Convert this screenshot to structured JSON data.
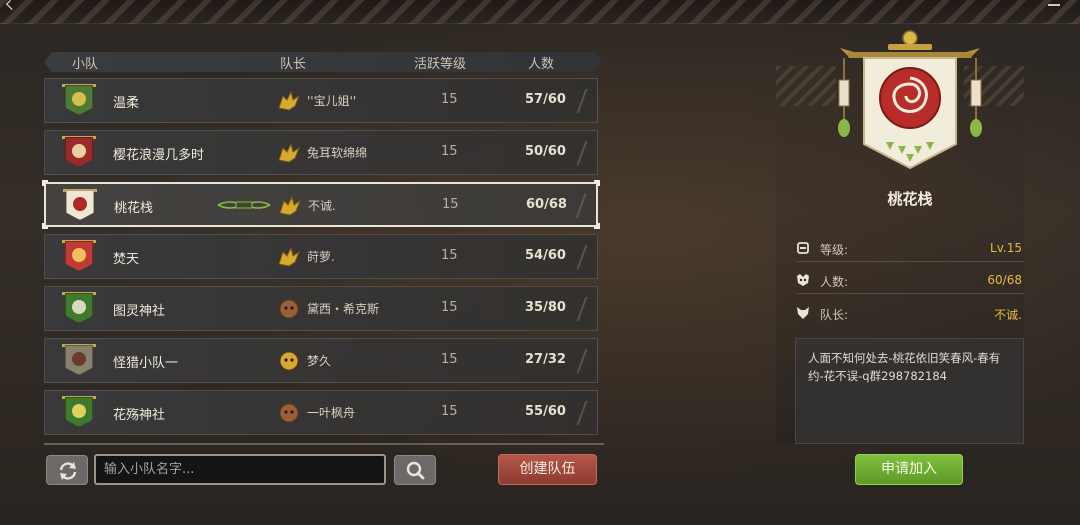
{
  "list": {
    "headers": {
      "team": "小队",
      "leader": "队长",
      "activity_level": "活跃等级",
      "member_count": "人数"
    },
    "rows": [
      {
        "name": "温柔",
        "leader": "''宝儿姐''",
        "level": "15",
        "count": "57/60",
        "crest_color": "#4e7a34",
        "emblem_color": "#d4c050",
        "leader_icon": "gold-dragon-icon",
        "leader_icon_color": "#d8a830"
      },
      {
        "name": "樱花浪漫几多时",
        "leader": "兔耳软绵绵",
        "level": "15",
        "count": "50/60",
        "crest_color": "#9c2a2a",
        "emblem_color": "#e8d0a0",
        "leader_icon": "gold-dragon-icon",
        "leader_icon_color": "#d8a830"
      },
      {
        "name": "桃花栈",
        "leader": "不诚.",
        "level": "15",
        "count": "60/68",
        "crest_color": "#efe8d4",
        "emblem_color": "#b02828",
        "leader_icon": "gold-dragon-icon",
        "leader_icon_color": "#d8a830",
        "selected": true
      },
      {
        "name": "焚天",
        "leader": "莳萝.",
        "level": "15",
        "count": "54/60",
        "crest_color": "#c23a34",
        "emblem_color": "#f0c060",
        "leader_icon": "gold-dragon-icon",
        "leader_icon_color": "#d8a830"
      },
      {
        "name": "图灵神社",
        "leader": "黛西・希克斯",
        "level": "15",
        "count": "35/80",
        "crest_color": "#3f7a2c",
        "emblem_color": "#d8d8c0",
        "leader_icon": "bronze-beast-icon",
        "leader_icon_color": "#9a6038"
      },
      {
        "name": "怪猎小队一",
        "leader": "梦久",
        "level": "15",
        "count": "27/32",
        "crest_color": "#8a8070",
        "emblem_color": "#6a3a2a",
        "leader_icon": "gold-beast-icon",
        "leader_icon_color": "#d8a830"
      },
      {
        "name": "花殇神社",
        "leader": "一叶枫舟",
        "level": "15",
        "count": "55/60",
        "crest_color": "#3f7a2c",
        "emblem_color": "#e0d060",
        "leader_icon": "bronze-beast-icon",
        "leader_icon_color": "#9a6038"
      }
    ]
  },
  "search": {
    "placeholder": "输入小队名字..."
  },
  "buttons": {
    "create_team": "创建队伍",
    "apply_join": "申请加入",
    "refresh_icon": "refresh-icon",
    "search_icon": "search-icon"
  },
  "detail": {
    "team_name": "桃花栈",
    "crest_icon": "red-rose-banner-icon",
    "stats": [
      {
        "label": "等级:",
        "value": "Lv.15",
        "icon": "helmet-icon"
      },
      {
        "label": "人数:",
        "value": "60/68",
        "icon": "mask-icon"
      },
      {
        "label": "队长:",
        "value": "不诚.",
        "icon": "wolf-icon"
      }
    ],
    "description": "人面不知何处去-桃花依旧笑春风-春有约-花不误-q群298782184"
  },
  "colors": {
    "accent_value": "#e8b840",
    "create_button": "#a84a3e",
    "apply_button": "#6fae32"
  }
}
